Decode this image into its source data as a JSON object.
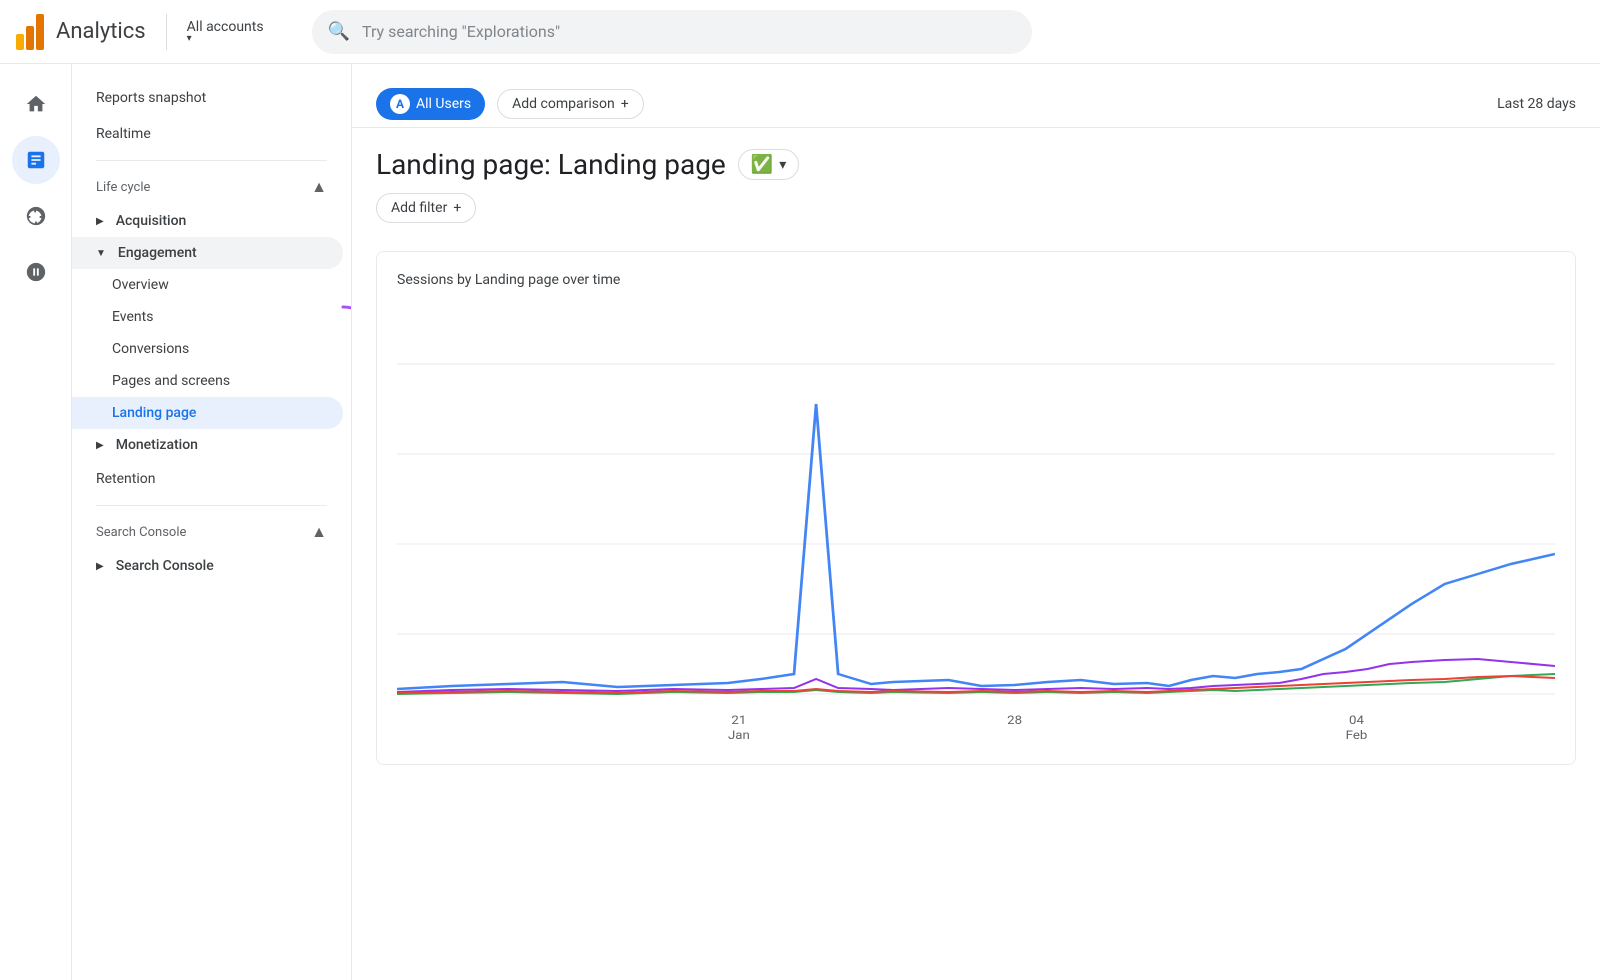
{
  "header": {
    "app_name": "Analytics",
    "all_accounts": "All accounts",
    "search_placeholder": "Try searching \"Explorations\""
  },
  "icon_nav": [
    {
      "name": "home-icon",
      "symbol": "⌂",
      "active": false
    },
    {
      "name": "reports-icon",
      "symbol": "📊",
      "active": true
    },
    {
      "name": "explore-icon",
      "symbol": "◎",
      "active": false
    },
    {
      "name": "advertising-icon",
      "symbol": "⟳",
      "active": false
    }
  ],
  "sidebar": {
    "reports_snapshot": "Reports snapshot",
    "realtime": "Realtime",
    "lifecycle_section": "Life cycle",
    "acquisition": "Acquisition",
    "engagement": "Engagement",
    "engagement_children": [
      {
        "label": "Overview"
      },
      {
        "label": "Events"
      },
      {
        "label": "Conversions"
      },
      {
        "label": "Pages and screens"
      },
      {
        "label": "Landing page",
        "active": true
      }
    ],
    "monetization": "Monetization",
    "retention": "Retention",
    "search_console_section": "Search Console",
    "search_console_child": "Search Console"
  },
  "content": {
    "segment_label": "All Users",
    "segment_avatar": "A",
    "add_comparison": "Add comparison",
    "date_range": "Last 28 days",
    "page_title": "Landing page: Landing page",
    "add_filter": "Add filter",
    "chart_title": "Sessions by Landing page over time",
    "x_labels": [
      "21\nJan",
      "28",
      "04\nFeb"
    ],
    "check_icon": "✓"
  }
}
